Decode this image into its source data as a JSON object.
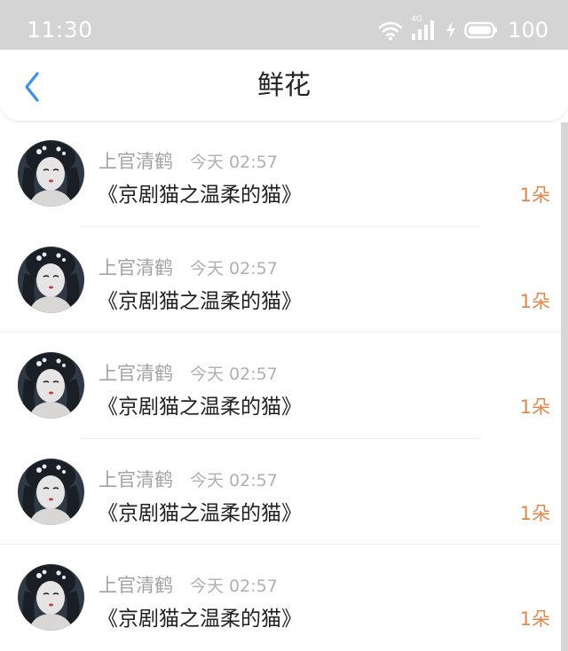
{
  "status_bar": {
    "time": "11:30",
    "network": "4G",
    "battery": "100",
    "icons": [
      "wifi-icon",
      "signal-icon",
      "charging-icon",
      "battery-icon"
    ]
  },
  "header": {
    "title": "鲜花",
    "back_icon": "chevron-left-icon",
    "accent_color": "#3a8ff0"
  },
  "items": [
    {
      "user": "上官清鹤",
      "time": "今天 02:57",
      "title": "《京剧猫之温柔的猫》",
      "count": "1朵"
    },
    {
      "user": "上官清鹤",
      "time": "今天 02:57",
      "title": "《京剧猫之温柔的猫》",
      "count": "1朵"
    },
    {
      "user": "上官清鹤",
      "time": "今天 02:57",
      "title": "《京剧猫之温柔的猫》",
      "count": "1朵"
    },
    {
      "user": "上官清鹤",
      "time": "今天 02:57",
      "title": "《京剧猫之温柔的猫》",
      "count": "1朵"
    },
    {
      "user": "上官清鹤",
      "time": "今天 02:57",
      "title": "《京剧猫之温柔的猫》",
      "count": "1朵"
    }
  ]
}
